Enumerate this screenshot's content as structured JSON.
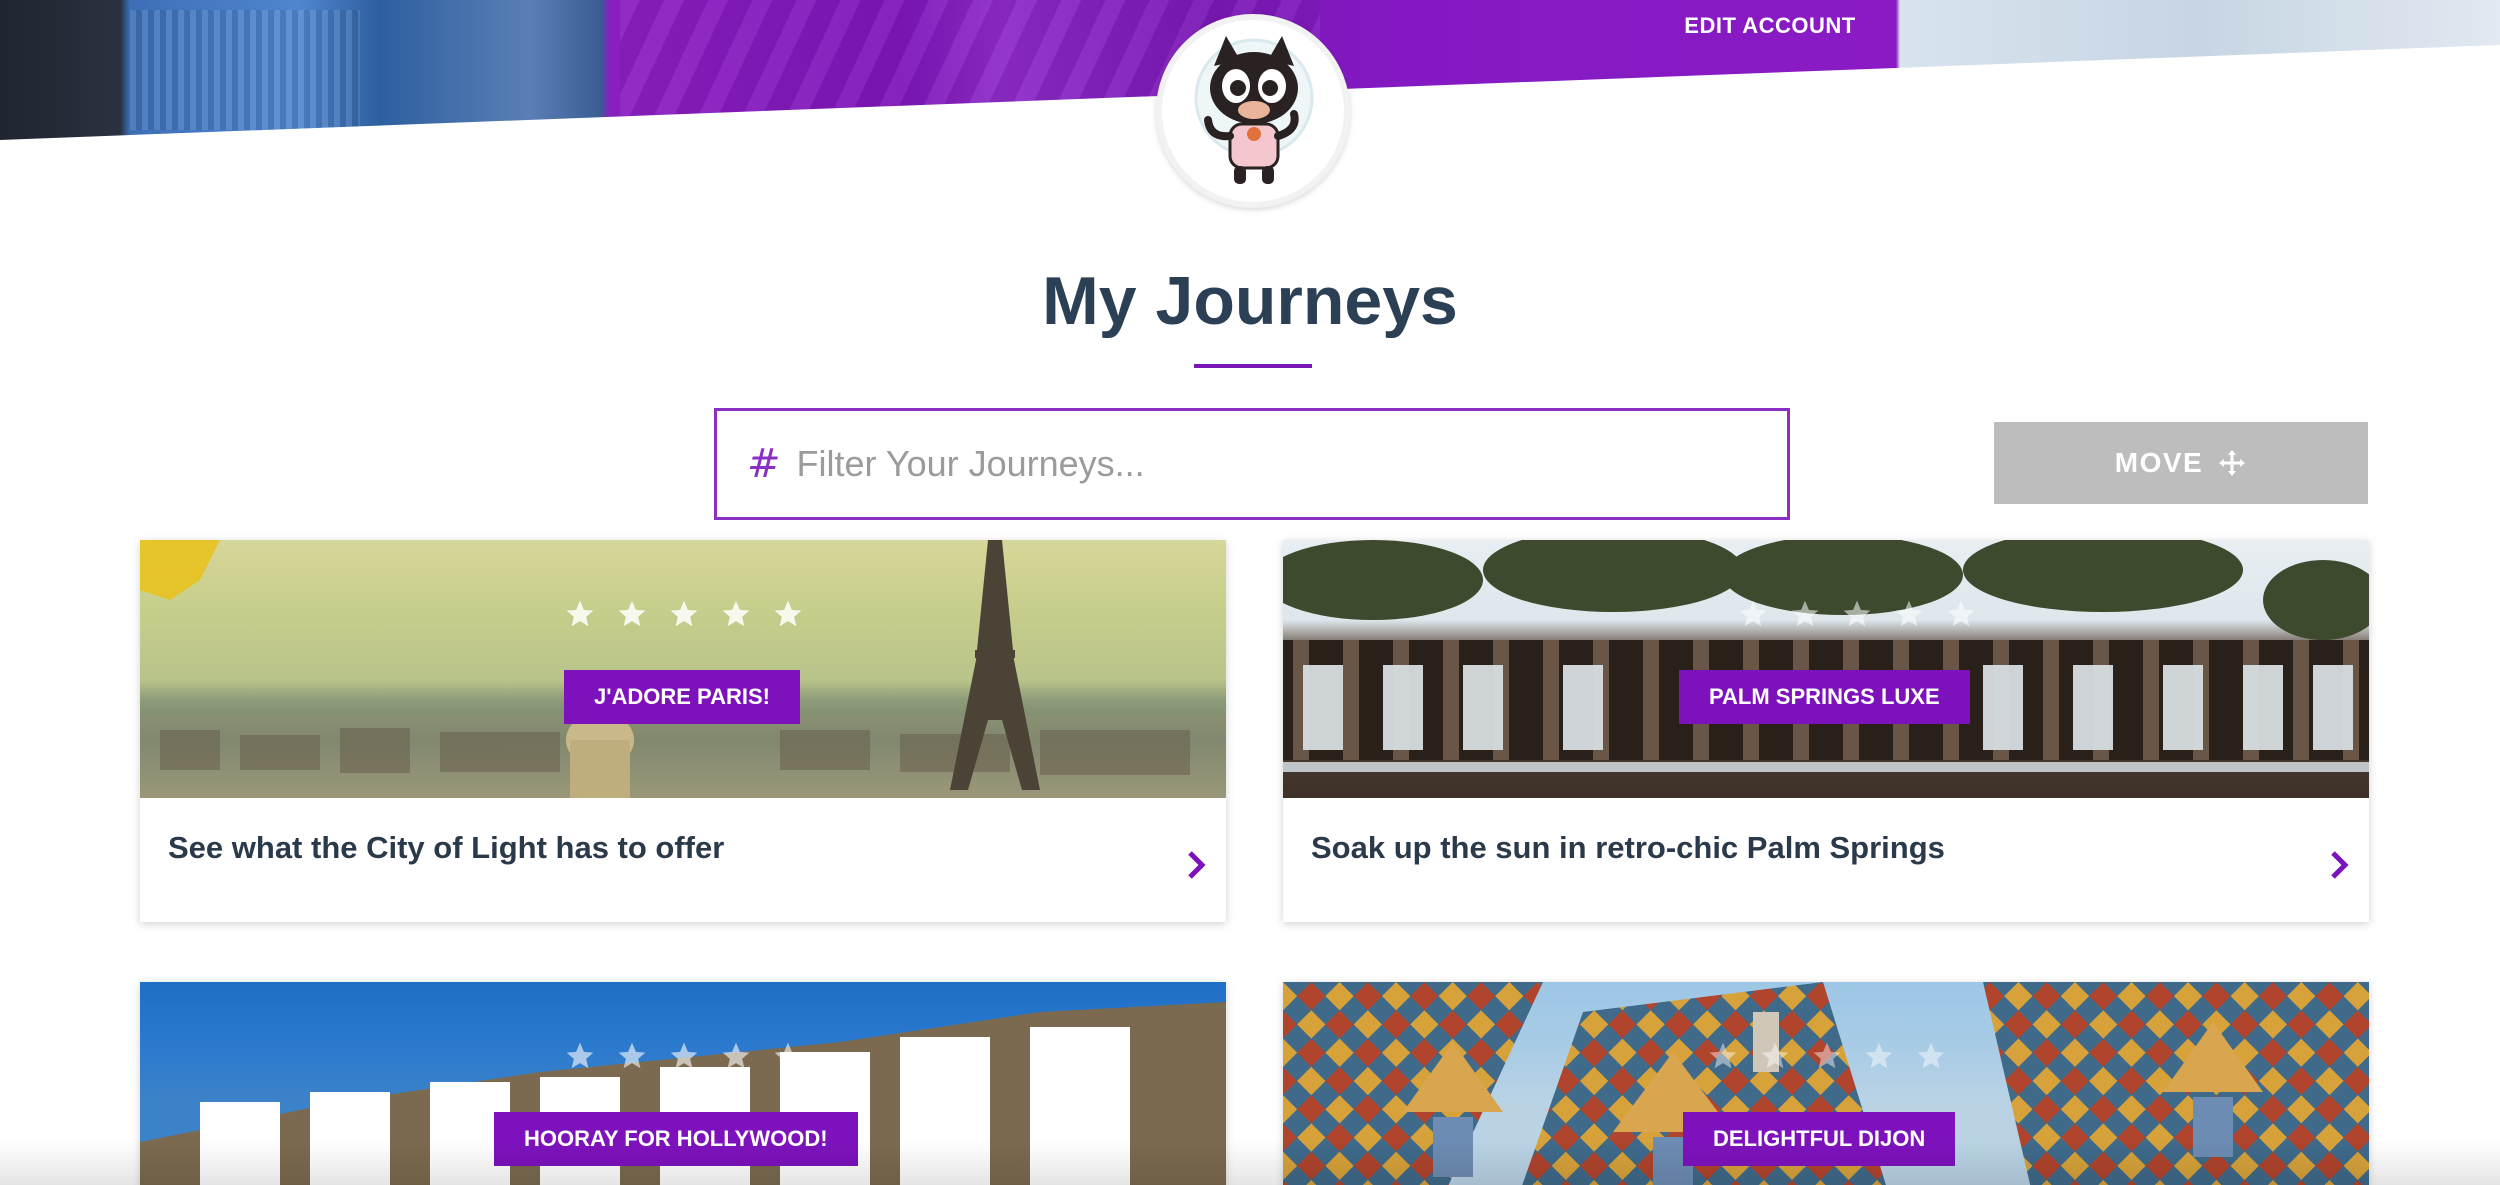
{
  "header": {
    "edit_account_label": "EDIT ACCOUNT",
    "accent_color": "#8a1bc4"
  },
  "page": {
    "title": "My Journeys"
  },
  "filter": {
    "hash_glyph": "#",
    "placeholder": "Filter Your Journeys...",
    "value": ""
  },
  "toolbar": {
    "move_label": "MOVE"
  },
  "icons": {
    "avatar": "cartoon-cat-astronaut-avatar",
    "move": "move-arrows-icon",
    "chevron": "chevron-right-icon",
    "star": "star-icon"
  },
  "journeys": [
    {
      "tag": "J'ADORE PARIS!",
      "caption": "See what the City of Light has to offer",
      "stars": 5
    },
    {
      "tag": "PALM SPRINGS LUXE",
      "caption": "Soak up the sun in retro-chic Palm Springs",
      "stars": 5
    },
    {
      "tag": "HOORAY FOR HOLLYWOOD!",
      "caption": "",
      "stars": 5
    },
    {
      "tag": "DELIGHTFUL DIJON",
      "caption": "",
      "stars": 5
    }
  ]
}
